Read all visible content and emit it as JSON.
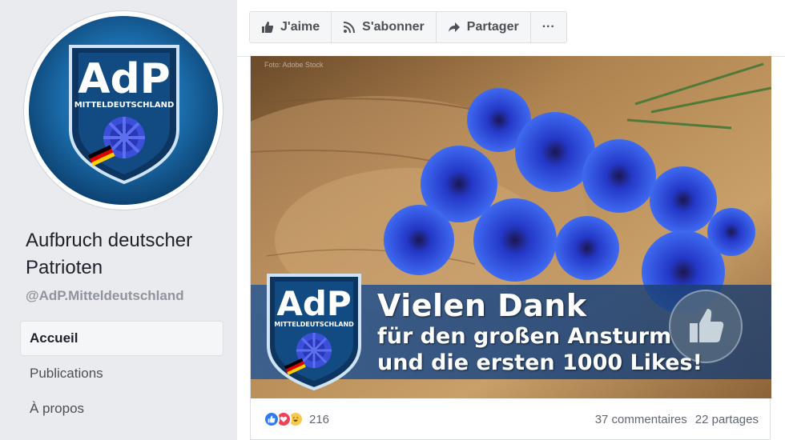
{
  "sidebar": {
    "avatar_logo_text": "AdP",
    "avatar_logo_sub": "MITTELDEUTSCHLAND",
    "page_name": "Aufbruch deutscher Patrioten",
    "handle": "@AdP.Mitteldeutschland",
    "nav": [
      {
        "label": "Accueil",
        "active": true
      },
      {
        "label": "Publications",
        "active": false
      },
      {
        "label": "À propos",
        "active": false
      }
    ]
  },
  "actionbar": {
    "like_label": "J'aime",
    "subscribe_label": "S'abonner",
    "share_label": "Partager",
    "more_label": "···"
  },
  "post": {
    "watermark": "Foto: Adobe Stock",
    "banner_logo_text": "AdP",
    "banner_logo_sub": "MITTELDEUTSCHLAND",
    "headline": "Vielen Dank",
    "line2": "für den großen Ansturm",
    "line3": "und die ersten 1000 Likes!",
    "reaction_count": "216",
    "comments": "37 commentaires",
    "shares": "22 partages"
  },
  "colors": {
    "accent_blue": "#2f7bf5",
    "love_red": "#f0405a",
    "haha_yellow": "#f7c94a",
    "banner_blue": "#285896"
  }
}
